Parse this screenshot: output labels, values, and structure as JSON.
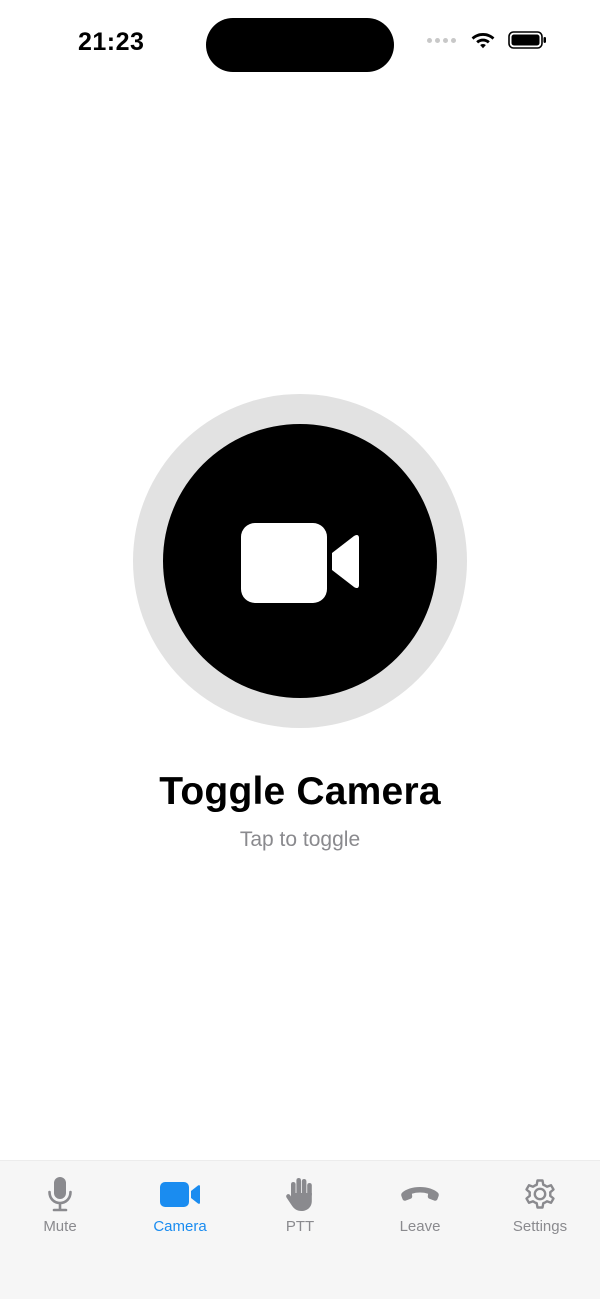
{
  "status_bar": {
    "time": "21:23"
  },
  "main": {
    "title": "Toggle Camera",
    "subtitle": "Tap to toggle",
    "button_icon": "video-camera-icon",
    "outer_ring_color": "#e2e2e2",
    "button_color": "#000000"
  },
  "tabs": [
    {
      "label": "Mute",
      "icon": "microphone-icon",
      "active": false
    },
    {
      "label": "Camera",
      "icon": "video-camera-icon",
      "active": true
    },
    {
      "label": "PTT",
      "icon": "hand-icon",
      "active": false
    },
    {
      "label": "Leave",
      "icon": "phone-hangup-icon",
      "active": false
    },
    {
      "label": "Settings",
      "icon": "gear-icon",
      "active": false
    }
  ],
  "colors": {
    "accent": "#1a8cf0",
    "inactive": "#8a8a8e"
  }
}
